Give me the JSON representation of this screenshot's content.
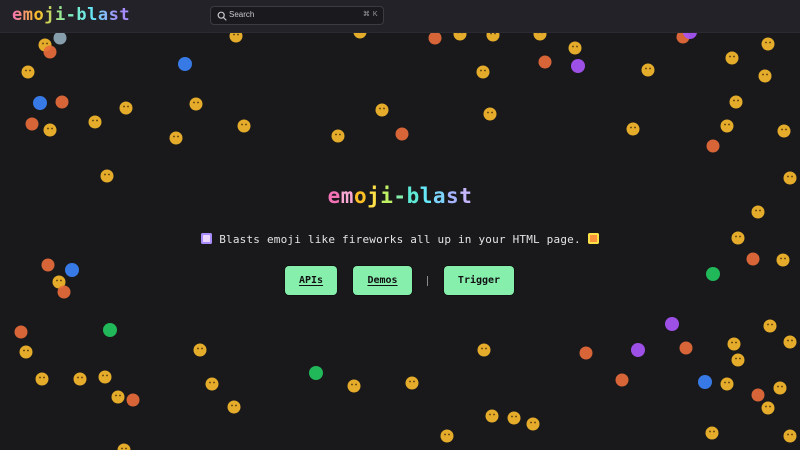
{
  "header": {
    "logo": "emoji-blast",
    "search": {
      "placeholder": "Search",
      "shortcut": "⌘ K"
    }
  },
  "hero": {
    "title_chars": [
      "e",
      "m",
      "o",
      "j",
      "i",
      "-",
      "b",
      "l",
      "a",
      "s",
      "t"
    ],
    "tagline": " Blasts emoji like fireworks all up in your HTML page. "
  },
  "actions": {
    "apis_label": "APIs",
    "demos_label": "Demos",
    "trigger_label": "Trigger"
  },
  "colors": {
    "background": "#19191c",
    "header": "#222228",
    "button": "#86efac",
    "title_palette": [
      "#f472b6",
      "#f9a8d4",
      "#fbbf24",
      "#fde047",
      "#bef264",
      "#86efac",
      "#5eead4",
      "#67e8f9",
      "#7dd3fc",
      "#a5b4fc",
      "#c4b5fd"
    ]
  }
}
